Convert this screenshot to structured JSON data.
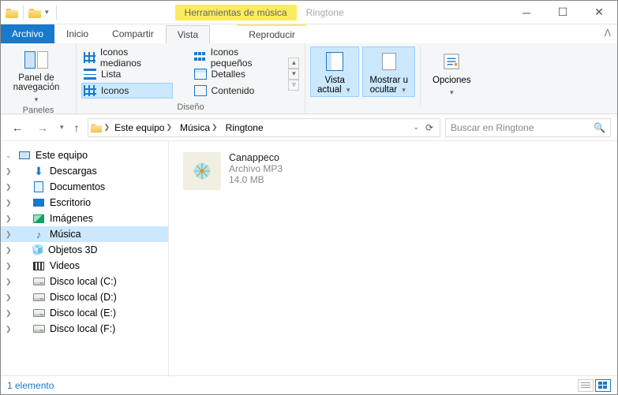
{
  "title_context_tab": "Herramientas de música",
  "window_title": "Ringtone",
  "tabs": {
    "file": "Archivo",
    "home": "Inicio",
    "share": "Compartir",
    "view": "Vista",
    "play": "Reproducir"
  },
  "ribbon": {
    "panel_nav": "Panel de\nnavegación",
    "panels_group": "Paneles",
    "layout": {
      "medium": "Iconos medianos",
      "small": "Iconos pequeños",
      "list": "Lista",
      "details": "Detalles",
      "icons": "Iconos",
      "content": "Contenido",
      "group": "Diseño"
    },
    "current_view": "Vista\nactual",
    "show_hide": "Mostrar u\nocultar",
    "options": "Opciones"
  },
  "breadcrumb": [
    "Este equipo",
    "Música",
    "Ringtone"
  ],
  "search_placeholder": "Buscar en Ringtone",
  "nav": {
    "root": "Este equipo",
    "items": [
      "Descargas",
      "Documentos",
      "Escritorio",
      "Imágenes",
      "Música",
      "Objetos 3D",
      "Videos",
      "Disco local (C:)",
      "Disco local (D:)",
      "Disco local (E:)",
      "Disco local (F:)"
    ]
  },
  "file": {
    "name": "Canappeco",
    "type": "Archivo MP3",
    "size": "14.0 MB"
  },
  "status": "1 elemento"
}
